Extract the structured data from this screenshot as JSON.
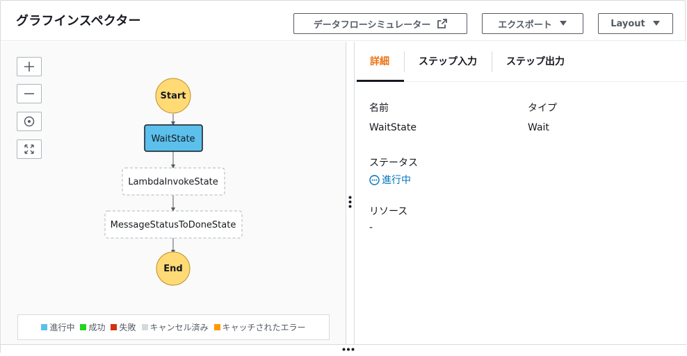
{
  "header": {
    "title": "グラフインスペクター",
    "buttons": {
      "simulator": "データフローシミュレーター",
      "export": "エクスポート",
      "layout": "Layout"
    }
  },
  "graph": {
    "nodes": {
      "start": "Start",
      "wait": "WaitState",
      "lambda": "LambdaInvokeState",
      "message": "MessageStatusToDoneState",
      "end": "End"
    }
  },
  "legend": [
    {
      "label": "進行中",
      "color": "#5bc0eb"
    },
    {
      "label": "成功",
      "color": "#1fd61f"
    },
    {
      "label": "失敗",
      "color": "#d13212"
    },
    {
      "label": "キャンセル済み",
      "color": "#d5dbdb"
    },
    {
      "label": "キャッチされたエラー",
      "color": "#ff9900"
    }
  ],
  "tabs": {
    "details": "詳細",
    "input": "ステップ入力",
    "output": "ステップ出力"
  },
  "details": {
    "name_label": "名前",
    "name_value": "WaitState",
    "type_label": "タイプ",
    "type_value": "Wait",
    "status_label": "ステータス",
    "status_value": "進行中",
    "resource_label": "リソース",
    "resource_value": "-"
  },
  "colors": {
    "accent_tab": "#ec7211",
    "status_link": "#0073bb",
    "active_node": "#5bc0eb",
    "terminal_node": "#ffda75"
  }
}
